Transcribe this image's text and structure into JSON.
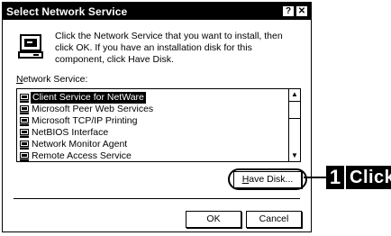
{
  "dialog": {
    "title": "Select Network Service",
    "help_glyph": "?",
    "close_glyph": "✕",
    "intro_text": "Click the Network Service that you want to install, then click OK.  If you have an installation disk for this component, click Have Disk.",
    "list_label_prefix": "N",
    "list_label_rest": "etwork Service:",
    "services": [
      "Client Service for NetWare",
      "Microsoft Peer Web Services",
      "Microsoft TCP/IP Printing",
      "NetBIOS Interface",
      "Network Monitor Agent",
      "Remote Access Service"
    ],
    "selected_index": 0,
    "scroll_up_glyph": "▲",
    "scroll_down_glyph": "▼",
    "have_disk_prefix": "H",
    "have_disk_rest": "ave Disk...",
    "ok_label": "OK",
    "cancel_label": "Cancel"
  },
  "callout": {
    "step_number": "1",
    "text": "Click"
  }
}
